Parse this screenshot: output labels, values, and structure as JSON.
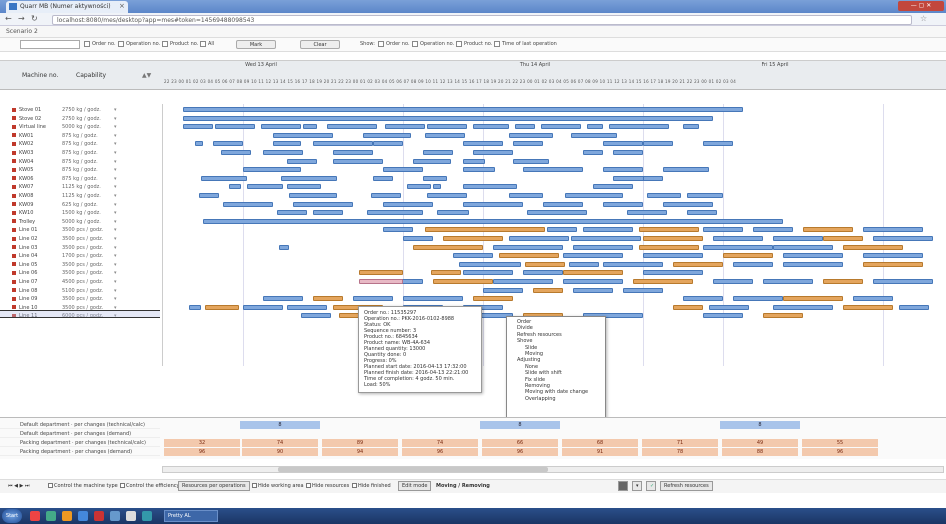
{
  "browser": {
    "tab_title": "Quarr MB (Numer aktywności)",
    "url": "localhost:8080/mes/desktop?app=mes#token=14569488098543",
    "controls_label": "— ▢ ✕"
  },
  "app": {
    "title": "Scenario 2"
  },
  "toolbar": {
    "show_orders": "Order no.",
    "show_operations": "Operation no.",
    "show_products": "Product no.",
    "show_all": "All",
    "mark_button": "Mark",
    "clear_button": "Clear",
    "show_label": "Show:",
    "opt_order": "Order no.",
    "opt_operation": "Operation no.",
    "opt_product": "Product no.",
    "opt_time": "Time of last operation"
  },
  "header": {
    "col_machine": "Machine no.",
    "col_capability": "Capability",
    "days": [
      "Wed 13 April",
      "Thu 14 April",
      "Fri 15 April"
    ],
    "hours": "22 23 00 01 02 03 04 05 06 07 08 09 10 11 12 13 14 15 16 17 18 19 20 21 22 23 00 01 02 03 04 05 06 07 08 09 10 11 12 13 14 15 16 17 18 19 20 21 22 23 00 01 02 03 04 05 06 07 08 09 10 11 12 13 14 15 16 17 18 19 20 21 22 23 00 01 02 03 04"
  },
  "machines": [
    {
      "name": "Stove 01",
      "cap": "2750 kg / godz."
    },
    {
      "name": "Stove 02",
      "cap": "2750 kg / godz."
    },
    {
      "name": "Virtual line",
      "cap": "5000 kg / godz."
    },
    {
      "name": "KW01",
      "cap": "875 kg / godz."
    },
    {
      "name": "KW02",
      "cap": "875 kg / godz."
    },
    {
      "name": "KW03",
      "cap": "875 kg / godz."
    },
    {
      "name": "KW04",
      "cap": "875 kg / godz."
    },
    {
      "name": "KW05",
      "cap": "875 kg / godz."
    },
    {
      "name": "KW06",
      "cap": "875 kg / godz."
    },
    {
      "name": "KW07",
      "cap": "1125 kg / godz."
    },
    {
      "name": "KW08",
      "cap": "1125 kg / godz."
    },
    {
      "name": "KW09",
      "cap": "625 kg / godz."
    },
    {
      "name": "KW10",
      "cap": "1500 kg / godz."
    },
    {
      "name": "Trolley",
      "cap": "5000 kg / godz."
    },
    {
      "name": "Line 01",
      "cap": "3500 pcs / godz."
    },
    {
      "name": "Line 02",
      "cap": "3500 pcs / godz."
    },
    {
      "name": "Line 03",
      "cap": "3500 pcs / godz."
    },
    {
      "name": "Line 04",
      "cap": "1700 pcs / godz."
    },
    {
      "name": "Line 05",
      "cap": "3500 pcs / godz."
    },
    {
      "name": "Line 06",
      "cap": "3500 pcs / godz."
    },
    {
      "name": "Line 07",
      "cap": "4500 pcs / godz."
    },
    {
      "name": "Line 08",
      "cap": "5100 pcs / godz."
    },
    {
      "name": "Line 09",
      "cap": "3500 pcs / godz."
    },
    {
      "name": "Line 10",
      "cap": "3500 pcs / godz."
    },
    {
      "name": "Line 11",
      "cap": "6000 pcs / godz."
    }
  ],
  "tooltip": [
    "Order no.: 11535297",
    "Operation no.: PKK-2016-0102-8988",
    "Status: OK",
    "Sequence number: 3",
    "Product no.: 6845634",
    "Product name: WB-4A-634",
    "Planned quantity: 13000",
    "Quantity done: 0",
    "Progress: 0%",
    "Planned start date: 2016-04-13 17:32:00",
    "Planned finish date: 2016-04-13 22:21:00",
    "Time of completion: 4 godz. 50 min.",
    "Load: 50%"
  ],
  "context_menu": [
    {
      "label": "Order",
      "sub": false
    },
    {
      "label": "Divide",
      "sub": false
    },
    {
      "label": "Refresh resources",
      "sub": false
    },
    {
      "label": "Shove",
      "sub": false
    },
    {
      "label": "Slide",
      "sub": true
    },
    {
      "label": "Moving",
      "sub": true
    },
    {
      "label": "Adjusting",
      "sub": false
    },
    {
      "label": "None",
      "sub": true
    },
    {
      "label": "Slide with shift",
      "sub": true
    },
    {
      "label": "Fix slide",
      "sub": true
    },
    {
      "label": "Removing",
      "sub": true
    },
    {
      "label": "Moving with date change",
      "sub": true
    },
    {
      "label": "Overlapping",
      "sub": true
    }
  ],
  "load": {
    "rows": [
      "Default department · per changes (technical/calc)",
      "Default department · per changes (demand)",
      "Packing department · per changes (technical/calc)",
      "Packing department · per changes (demand)"
    ],
    "blue_values": [
      "8",
      "8",
      "8"
    ],
    "orange_top": [
      "32",
      "74",
      "89",
      "74",
      "66",
      "68",
      "71",
      "49",
      "55"
    ],
    "orange_bottom": [
      "96",
      "90",
      "94",
      "96",
      "96",
      "91",
      "78",
      "88",
      "96"
    ]
  },
  "bottom_toolbar": {
    "check1": "Control the machine type",
    "check2": "Control the efficiency",
    "btn_resources": "Resources per operations",
    "check3": "Hide working area",
    "check4": "Hide resources",
    "check5": "Hide finished",
    "btn_edit": "Edit mode",
    "moving_label": "Moving / Removing",
    "btn_refresh": "Refresh resources"
  },
  "taskbar": {
    "start": "Start",
    "item": "Pretty AL"
  },
  "colors": {
    "bar": "#7fa7dc",
    "bar_border": "#4677b8",
    "orange": "#e4a55d",
    "taskbar": "#1a3564"
  }
}
